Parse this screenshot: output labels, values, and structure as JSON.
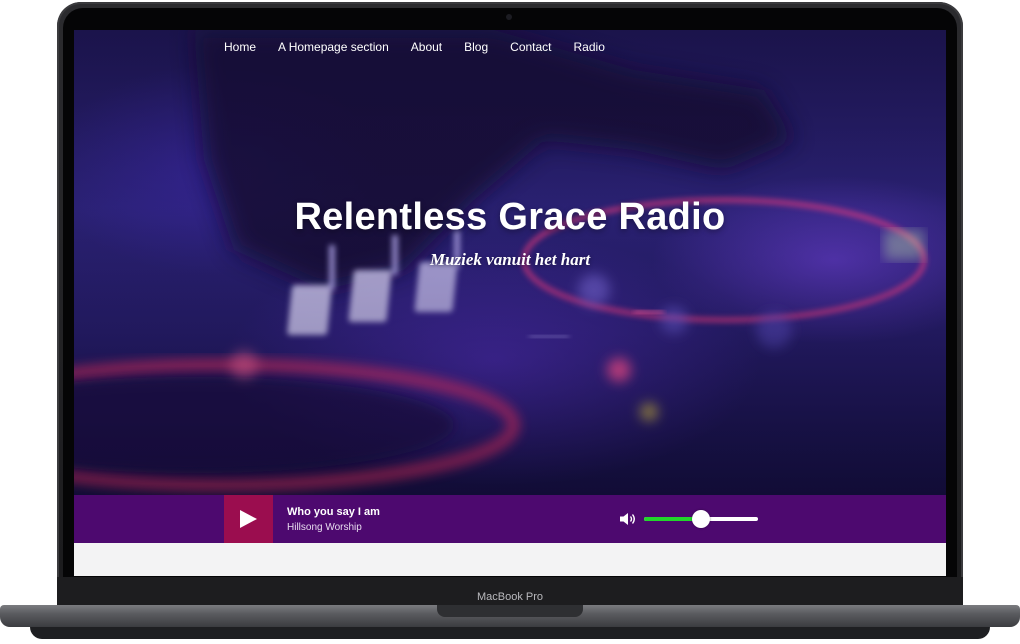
{
  "nav": [
    "Home",
    "A Homepage section",
    "About",
    "Blog",
    "Contact",
    "Radio"
  ],
  "hero": {
    "title": "Relentless Grace Radio",
    "subtitle": "Muziek vanuit het hart"
  },
  "player": {
    "track_title": "Who you say I am",
    "artist": "Hillsong Worship",
    "volume": 0.5
  },
  "device_label": "MacBook Pro",
  "colors": {
    "player_bg": "#4d096f",
    "play_button": "#9b0d4f",
    "volume_fill": "#22d62c"
  }
}
